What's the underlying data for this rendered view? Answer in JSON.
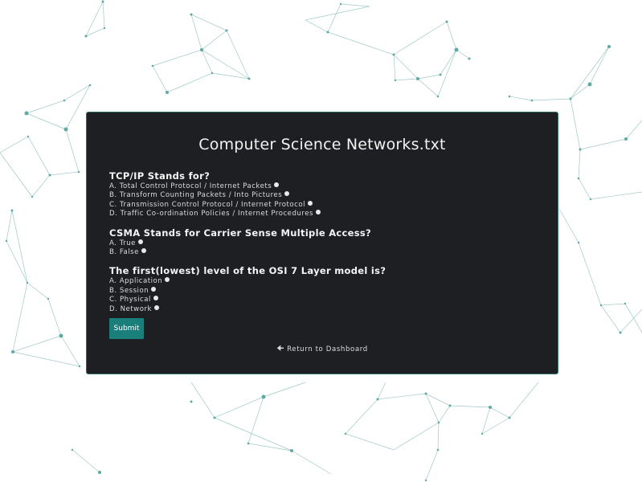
{
  "page": {
    "title": "Computer Science Networks.txt",
    "accent_color": "#1a7f7a",
    "card_color": "#1e1f23"
  },
  "questions": [
    {
      "text": "TCP/IP Stands for?",
      "options": [
        "A. Total Control Protocol / Internet Packets",
        "B. Transform Counting Packets / Into Pictures",
        "C. Transmission Control Protocol / Internet Protocol",
        "D. Traffic Co-ordination Policies / Internet Procedures"
      ]
    },
    {
      "text": "CSMA Stands for Carrier Sense Multiple Access?",
      "options": [
        "A. True",
        "B. False"
      ]
    },
    {
      "text": "The first(lowest) level of the OSI 7 Layer model is?",
      "options": [
        "A. Application",
        "B. Session",
        "C. Physical",
        "D. Network"
      ]
    }
  ],
  "actions": {
    "submit_label": "Submit",
    "return_label": "Return to Dashboard",
    "return_icon": "arrow-left-icon"
  }
}
